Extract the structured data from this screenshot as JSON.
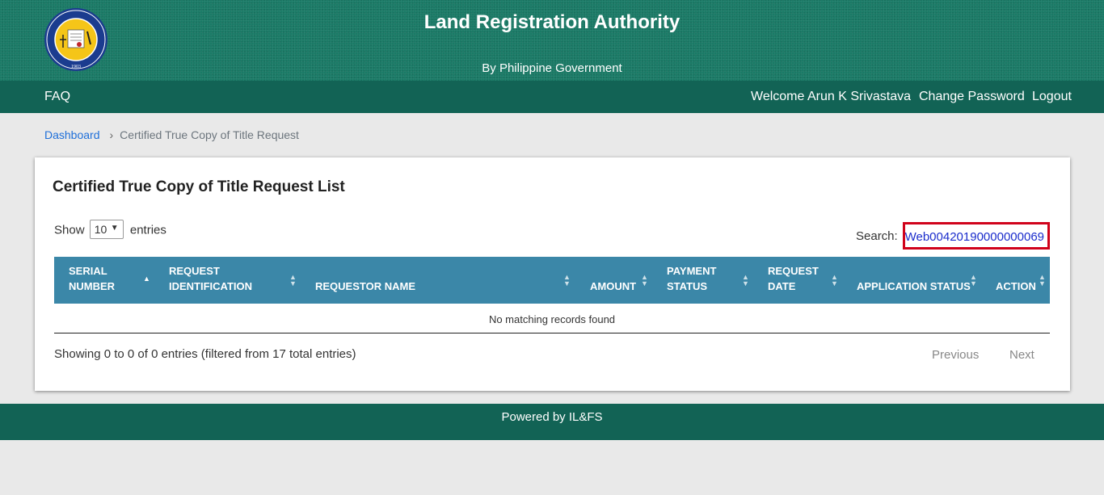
{
  "header": {
    "title": "Land Registration Authority",
    "subtitle": "By Philippine Government",
    "logo": {
      "ring_text": "LAND REGISTRATION AUTHORITY",
      "year": "1903"
    }
  },
  "nav": {
    "faq": "FAQ",
    "welcome": "Welcome Arun K Srivastava",
    "change_password": "Change Password",
    "logout": "Logout"
  },
  "breadcrumb": {
    "home": "Dashboard",
    "separator": "›",
    "current": "Certified True Copy of Title Request"
  },
  "card": {
    "title": "Certified True Copy of Title Request List",
    "show_label": "Show",
    "entries_value": "10",
    "entries_label": "entries",
    "search_label": "Search:",
    "search_value": "Web00420190000000069"
  },
  "table": {
    "columns": [
      {
        "label1": "SERIAL",
        "label2": "NUMBER"
      },
      {
        "label1": "REQUEST",
        "label2": "IDENTIFICATION"
      },
      {
        "label1": "",
        "label2": "REQUESTOR NAME"
      },
      {
        "label1": "",
        "label2": "AMOUNT"
      },
      {
        "label1": "PAYMENT",
        "label2": "STATUS"
      },
      {
        "label1": "REQUEST",
        "label2": "DATE"
      },
      {
        "label1": "",
        "label2": "APPLICATION STATUS"
      },
      {
        "label1": "",
        "label2": "ACTION"
      }
    ],
    "empty_message": "No matching records found",
    "info": "Showing 0 to 0 of 0 entries (filtered from 17 total entries)",
    "previous": "Previous",
    "next": "Next"
  },
  "footer": {
    "text": "Powered by IL&FS"
  },
  "colors": {
    "header_bg": "#1a7a66",
    "nav_bg": "#126355",
    "table_head": "#3b87a8",
    "search_border": "#d0021b"
  }
}
